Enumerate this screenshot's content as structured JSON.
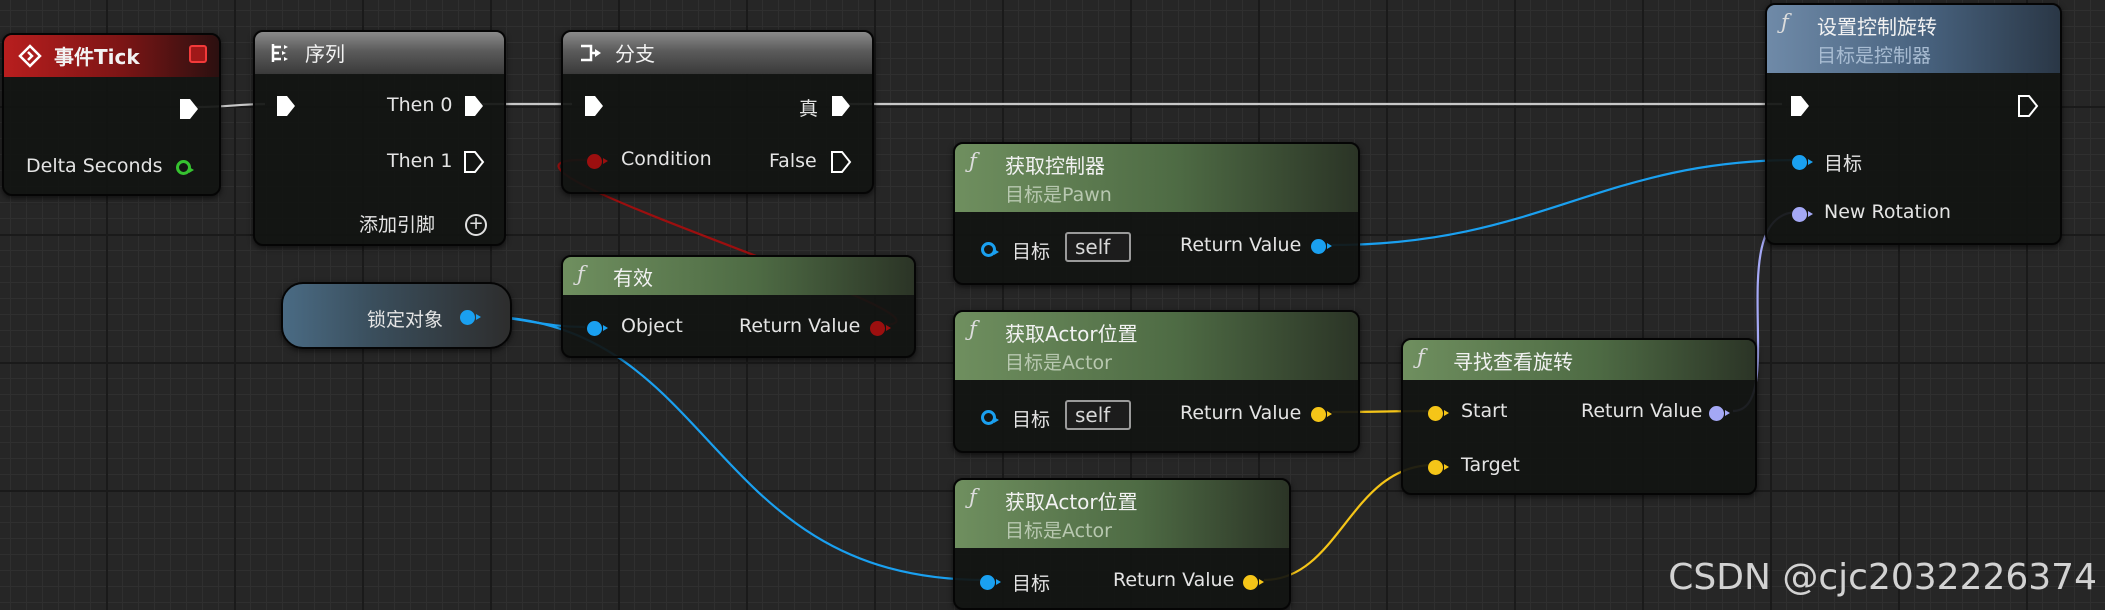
{
  "nodes": {
    "event_tick": {
      "title": "事件Tick",
      "delta_seconds": "Delta Seconds"
    },
    "sequence": {
      "title": "序列",
      "then0": "Then 0",
      "then1": "Then 1",
      "add_pin": "添加引脚"
    },
    "branch": {
      "title": "分支",
      "condition": "Condition",
      "true_label": "真",
      "false_label": "False"
    },
    "is_valid": {
      "title": "有效",
      "object": "Object",
      "return_value": "Return Value"
    },
    "lock_target": {
      "label": "锁定对象"
    },
    "get_controller": {
      "title": "获取控制器",
      "subtitle": "目标是Pawn",
      "target": "目标",
      "self": "self",
      "return_value": "Return Value"
    },
    "get_actor_location_1": {
      "title": "获取Actor位置",
      "subtitle": "目标是Actor",
      "target": "目标",
      "self": "self",
      "return_value": "Return Value"
    },
    "get_actor_location_2": {
      "title": "获取Actor位置",
      "subtitle": "目标是Actor",
      "target": "目标",
      "return_value": "Return Value"
    },
    "find_look_at": {
      "title": "寻找查看旋转",
      "start": "Start",
      "target": "Target",
      "return_value": "Return Value"
    },
    "set_control_rotation": {
      "title": "设置控制旋转",
      "subtitle": "目标是控制器",
      "target": "目标",
      "new_rotation": "New Rotation"
    }
  },
  "icons": {
    "function": "ƒ",
    "event": "event-diamond-icon",
    "sequence": "sequence-icon",
    "branch": "branch-icon"
  },
  "colors": {
    "exec": "#ffffff",
    "bool": "#9c0f0f",
    "object": "#1aa0f0",
    "vector": "#f5c518",
    "rotator": "#a4a8f5",
    "float": "#36c230"
  },
  "watermark": "CSDN @cjc2032226374"
}
